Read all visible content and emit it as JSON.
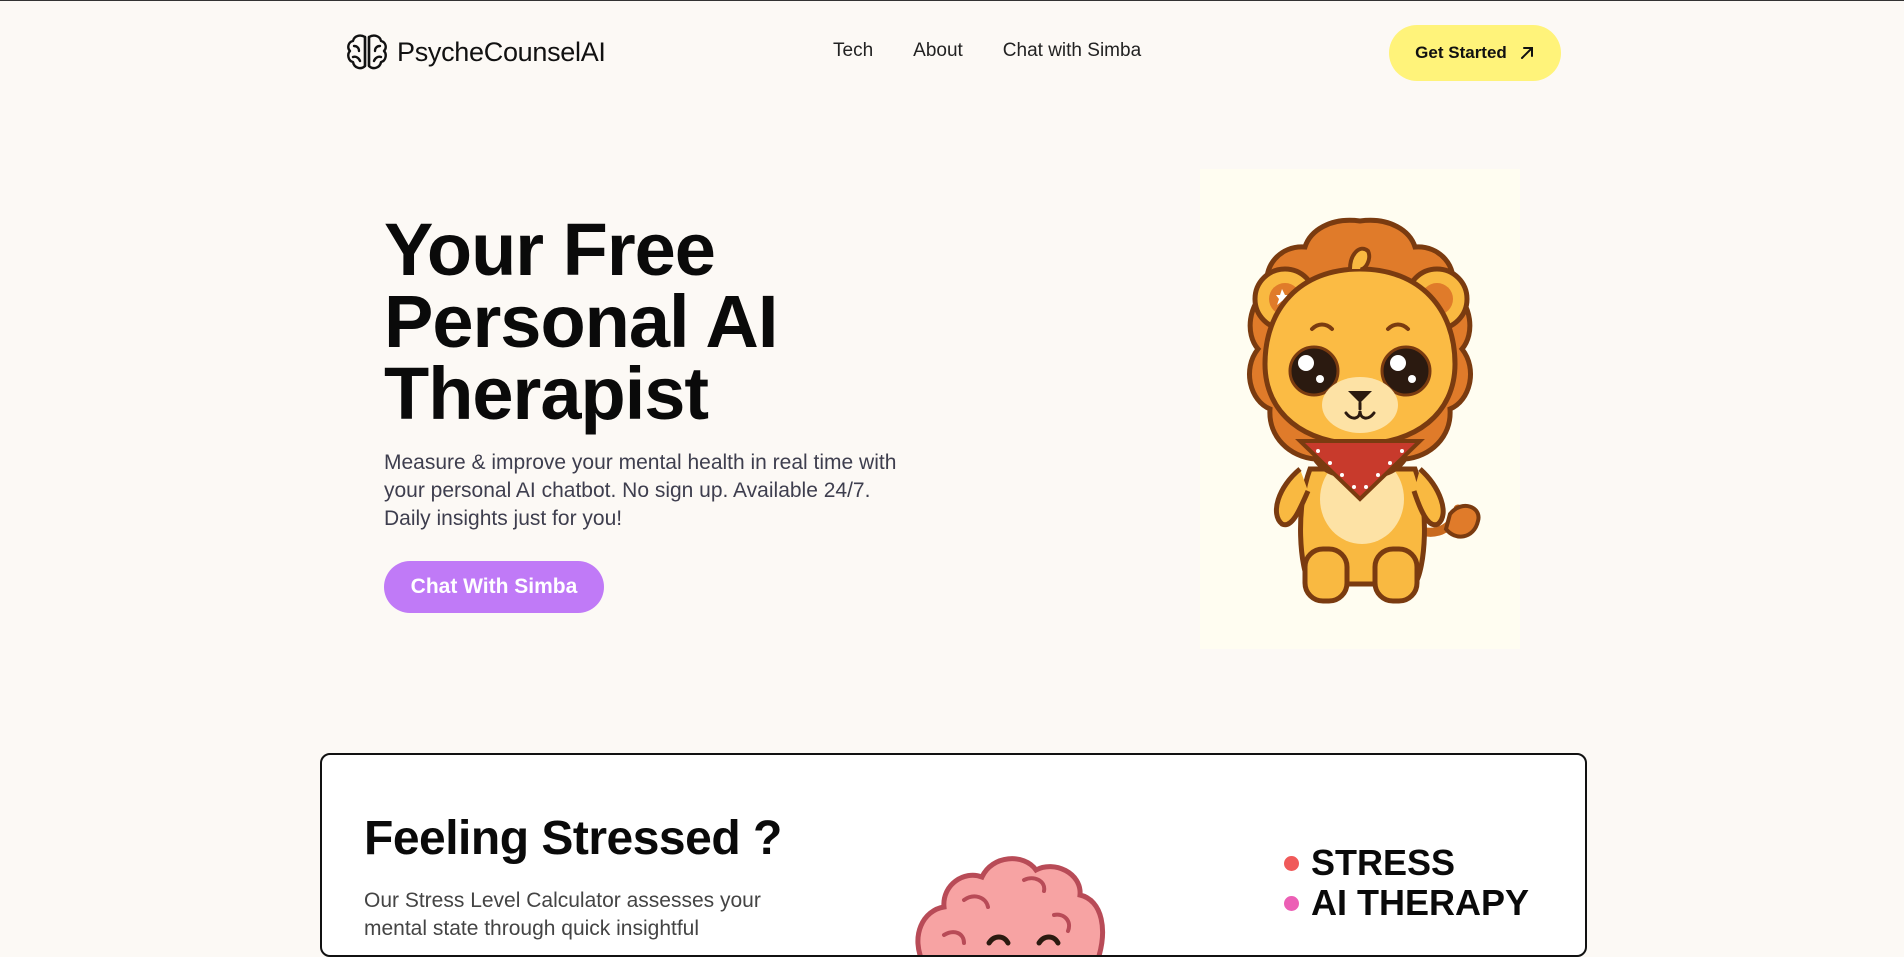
{
  "brand": {
    "name": "PsycheCounselAI",
    "icon": "brain-icon"
  },
  "nav": {
    "items": [
      {
        "label": "Tech"
      },
      {
        "label": "About"
      },
      {
        "label": "Chat with Simba"
      }
    ],
    "cta_label": "Get Started",
    "cta_icon": "arrow-up-right-icon",
    "cta_color": "#fff37a"
  },
  "hero": {
    "title_lines": [
      "Your Free",
      "Personal AI",
      "Therapist"
    ],
    "subtitle": "Measure & improve your mental health in real time with your personal AI chatbot. No sign up. Available 24/7. Daily insights just for you!",
    "button_label": "Chat With Simba",
    "button_color": "#c07af7",
    "image": "lion-mascot-illustration"
  },
  "stress_section": {
    "title": "Feeling Stressed ?",
    "text": "Our Stress Level Calculator assesses your mental state through quick insightful",
    "image": "brain-mascot-illustration",
    "tags": [
      {
        "label": "STRESS",
        "color": "#f05a5a"
      },
      {
        "label": "AI THERAPY",
        "color": "#ec5fb5"
      }
    ]
  }
}
